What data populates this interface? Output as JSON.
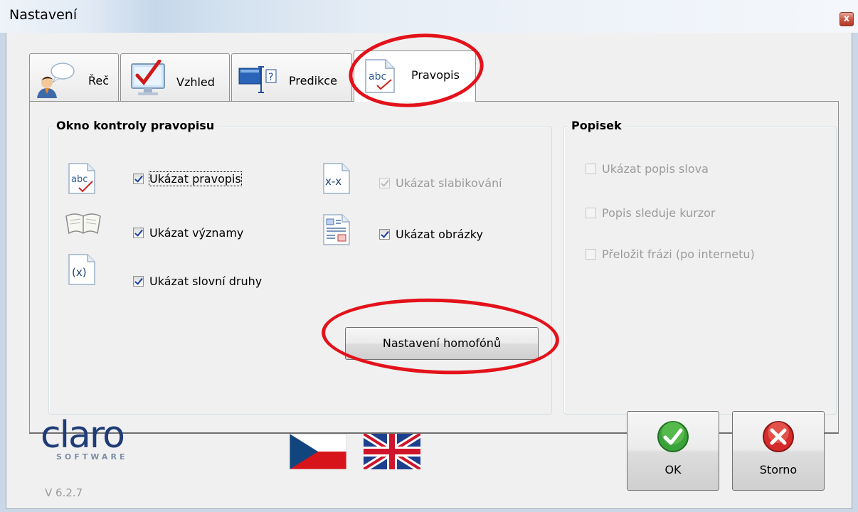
{
  "window": {
    "title": "Nastavení",
    "close_glyph": "x"
  },
  "tabs": [
    {
      "label": "Řeč",
      "icon": "speech-person-icon",
      "active": false
    },
    {
      "label": "Vzhled",
      "icon": "monitor-check-icon",
      "active": false
    },
    {
      "label": "Predikce",
      "icon": "prediction-icon",
      "active": false
    },
    {
      "label": "Pravopis",
      "icon": "abc-spell-icon",
      "active": true
    }
  ],
  "spell_group": {
    "title": "Okno kontroly pravopisu",
    "items": [
      {
        "label": "Ukázat pravopis",
        "checked": true,
        "enabled": true,
        "icon": "abc-spell-icon",
        "icon_text": "abc"
      },
      {
        "label": "Ukázat významy",
        "checked": true,
        "enabled": true,
        "icon": "book-icon"
      },
      {
        "label": "Ukázat slovní druhy",
        "checked": true,
        "enabled": true,
        "icon": "word-type-icon",
        "icon_text": "(x)"
      },
      {
        "label": "Ukázat slabikování",
        "checked": true,
        "enabled": false,
        "icon": "syllable-icon",
        "icon_text": "x-x"
      },
      {
        "label": "Ukázat obrázky",
        "checked": true,
        "enabled": true,
        "icon": "pictures-icon"
      }
    ],
    "homophones_button": "Nastavení homofónů"
  },
  "caption_group": {
    "title": "Popisek",
    "items": [
      {
        "label": "Ukázat popis slova",
        "checked": false,
        "enabled": false
      },
      {
        "label": "Popis sleduje kurzor",
        "checked": false,
        "enabled": false
      },
      {
        "label": "Přeložit frázi (po internetu)",
        "checked": false,
        "enabled": false
      }
    ]
  },
  "footer": {
    "logo_text": "claro",
    "logo_sub": "SOFTWARE",
    "version": "V 6.2.7",
    "flags": [
      "czech-flag-icon",
      "uk-flag-icon"
    ],
    "ok_label": "OK",
    "cancel_label": "Storno"
  },
  "colors": {
    "annotation": "#e3121a",
    "logo": "#1f3c78",
    "ok_green": "#3aa23a",
    "cancel_red": "#d42a2a"
  }
}
